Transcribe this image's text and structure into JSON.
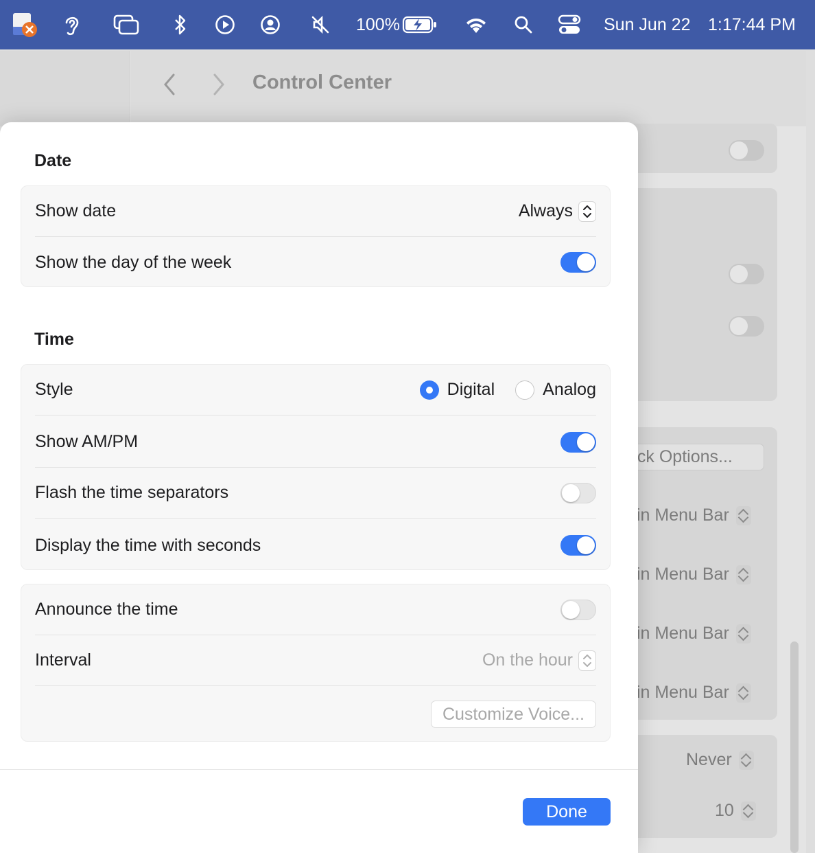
{
  "menubar": {
    "battery_percent": "100%",
    "date": "Sun Jun 22",
    "time": "1:17:44 PM",
    "icons": [
      "app-icon",
      "ear-icon",
      "windows-icon",
      "bluetooth-icon",
      "play-icon",
      "user-icon",
      "mute-icon",
      "battery-icon",
      "wifi-icon",
      "search-icon",
      "control-center-icon"
    ]
  },
  "window": {
    "title": "Control Center",
    "back_label": "<",
    "forward_label": ">",
    "bg_clock_options": "ock Options...",
    "bg_menubar_options": [
      "in Menu Bar",
      "in Menu Bar",
      "in Menu Bar",
      "in Menu Bar"
    ],
    "bg_never": "Never",
    "bg_ten": "10"
  },
  "sheet": {
    "date_section": {
      "title": "Date",
      "show_date_label": "Show date",
      "show_date_value": "Always",
      "show_day_label": "Show the day of the week",
      "show_day_on": true
    },
    "time_section": {
      "title": "Time",
      "style_label": "Style",
      "style_options": [
        "Digital",
        "Analog"
      ],
      "style_selected": "Digital",
      "ampm_label": "Show AM/PM",
      "ampm_on": true,
      "flash_label": "Flash the time separators",
      "flash_on": false,
      "seconds_label": "Display the time with seconds",
      "seconds_on": true
    },
    "announce_section": {
      "announce_label": "Announce the time",
      "announce_on": false,
      "interval_label": "Interval",
      "interval_value": "On the hour",
      "customize_voice_label": "Customize Voice..."
    },
    "done_label": "Done"
  },
  "colors": {
    "menubar": "#3f5aa6",
    "accent": "#3478f6"
  }
}
